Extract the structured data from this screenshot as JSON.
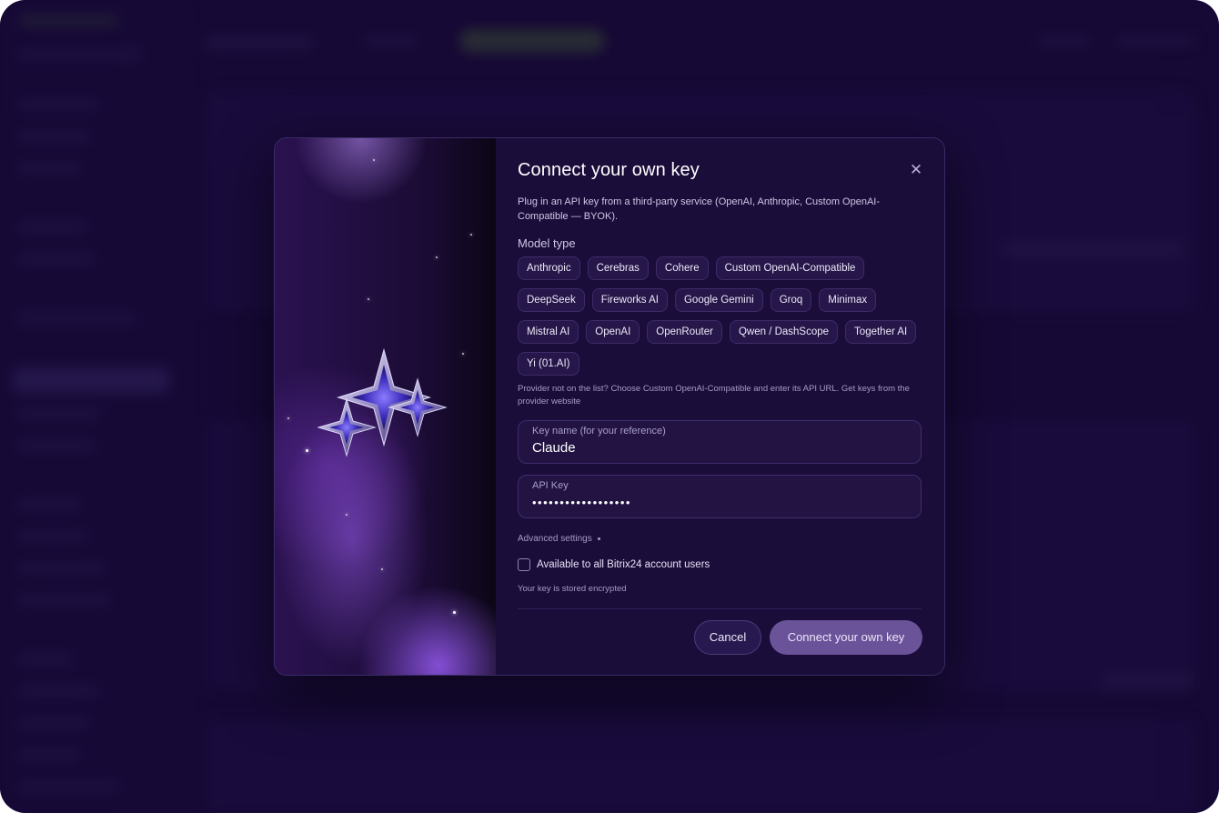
{
  "modal": {
    "title": "Connect your own key",
    "description": "Plug in an API key from a third-party service (OpenAI, Anthropic, Custom OpenAI-Compatible — BYOK).",
    "close_icon": "close-icon",
    "model_type_label": "Model type",
    "providers": [
      "Anthropic",
      "Cerebras",
      "Cohere",
      "Custom OpenAI-Compatible",
      "DeepSeek",
      "Fireworks AI",
      "Google Gemini",
      "Groq",
      "Minimax",
      "Mistral AI",
      "OpenAI",
      "OpenRouter",
      "Qwen / DashScope",
      "Together AI",
      "Yi (01.AI)"
    ],
    "provider_hint": "Provider not on the list? Choose Custom OpenAI-Compatible and enter its API URL. Get keys from the provider website",
    "key_name": {
      "label": "Key name (for your reference)",
      "value": "Claude"
    },
    "api_key": {
      "label": "API Key",
      "value": "••••••••••••••••••"
    },
    "advanced_label": "Advanced settings",
    "share_checkbox": {
      "label": "Available to all Bitrix24 account users",
      "checked": false
    },
    "stored_note": "Your key is stored encrypted",
    "cancel_label": "Cancel",
    "connect_label": "Connect your own key"
  },
  "colors": {
    "background": "#1a0b3c",
    "modal_bg": "#1b0d3a",
    "chip_bg": "#261649",
    "primary_button": "#6b5399"
  }
}
